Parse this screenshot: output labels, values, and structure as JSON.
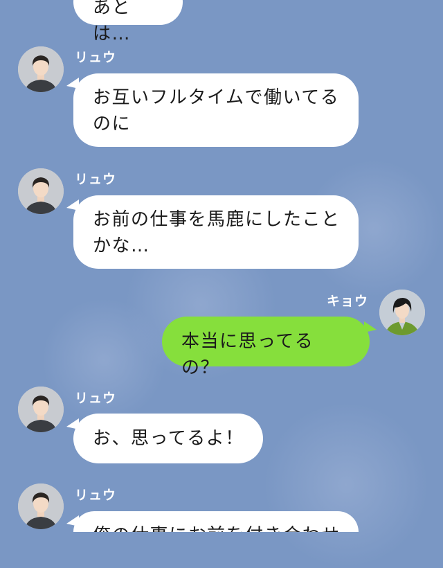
{
  "messages": [
    {
      "sender": "",
      "side": "left",
      "text": "あとは…"
    },
    {
      "sender": "リュウ",
      "side": "left",
      "text": "お互いフルタイムで働いてる\nのに"
    },
    {
      "sender": "リュウ",
      "side": "left",
      "text": "お前の仕事を馬鹿にしたこと\nかな…"
    },
    {
      "sender": "キョウ",
      "side": "right",
      "text": "本当に思ってるの？"
    },
    {
      "sender": "リュウ",
      "side": "left",
      "text": "お、思ってるよ！"
    },
    {
      "sender": "リュウ",
      "side": "left",
      "text": "俺の仕事にお前を付き合わせ"
    }
  ],
  "colors": {
    "background": "#7a97c4",
    "incoming_bubble": "#ffffff",
    "outgoing_bubble": "#86df3c"
  },
  "icons": {
    "male_avatar": "male-avatar-icon",
    "female_avatar": "female-avatar-icon"
  }
}
